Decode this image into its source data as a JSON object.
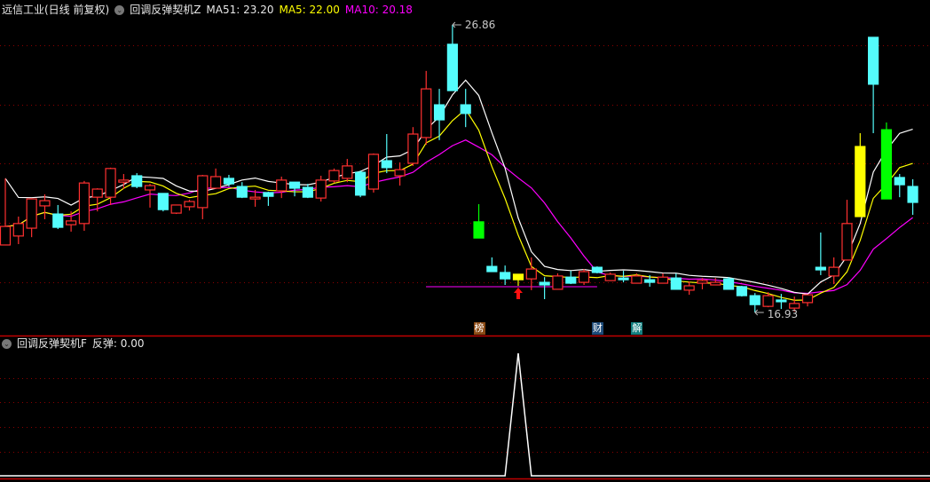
{
  "main_header": {
    "title": "远信工业(日线 前复权)",
    "indicator_name": "回调反弹契机Z",
    "ma51_label": "MA51: 23.20",
    "ma5_label": "MA5: 22.00",
    "ma10_label": "MA10: 20.18"
  },
  "sub_header": {
    "indicator_name": "回调反弹契机F",
    "value_label": "反弹: 0.00"
  },
  "markers": {
    "high_label": "26.86",
    "low_label": "16.93"
  },
  "badges": [
    {
      "text": "榜",
      "color": "#8b4a14"
    },
    {
      "text": "财",
      "color": "#1c4a78"
    },
    {
      "text": "解",
      "color": "#138080"
    }
  ],
  "colors": {
    "up": "#ff3030",
    "down": "#54fcfc",
    "ma51": "#ffffff",
    "ma5": "#ffff00",
    "ma10": "#ff00ff",
    "grid": "#8b0000",
    "signal_yellow": "#ffff00",
    "signal_green": "#00ff00"
  },
  "chart_data": {
    "type": "candlestick",
    "price_range": [
      16.93,
      26.86
    ],
    "candles": [
      {
        "o": 19.26,
        "h": 21.56,
        "l": 19.26,
        "c": 19.9
      },
      {
        "o": 19.57,
        "h": 20.24,
        "l": 19.29,
        "c": 20.0
      },
      {
        "o": 19.84,
        "h": 20.88,
        "l": 19.53,
        "c": 20.85
      },
      {
        "o": 20.61,
        "h": 21.01,
        "l": 20.15,
        "c": 20.79
      },
      {
        "o": 20.33,
        "h": 20.64,
        "l": 19.81,
        "c": 19.87
      },
      {
        "o": 19.96,
        "h": 20.42,
        "l": 19.72,
        "c": 20.09
      },
      {
        "o": 20.0,
        "h": 21.47,
        "l": 19.75,
        "c": 21.4
      },
      {
        "o": 20.91,
        "h": 21.22,
        "l": 20.42,
        "c": 21.19
      },
      {
        "o": 20.91,
        "h": 21.93,
        "l": 20.64,
        "c": 21.9
      },
      {
        "o": 21.43,
        "h": 21.71,
        "l": 21.19,
        "c": 21.5
      },
      {
        "o": 21.65,
        "h": 21.74,
        "l": 21.22,
        "c": 21.28
      },
      {
        "o": 21.16,
        "h": 21.37,
        "l": 20.55,
        "c": 21.31
      },
      {
        "o": 21.04,
        "h": 21.04,
        "l": 20.42,
        "c": 20.48
      },
      {
        "o": 20.36,
        "h": 20.64,
        "l": 20.33,
        "c": 20.64
      },
      {
        "o": 20.58,
        "h": 20.82,
        "l": 20.45,
        "c": 20.76
      },
      {
        "o": 20.55,
        "h": 21.68,
        "l": 20.15,
        "c": 21.65
      },
      {
        "o": 21.22,
        "h": 21.9,
        "l": 21.19,
        "c": 21.62
      },
      {
        "o": 21.56,
        "h": 21.68,
        "l": 21.28,
        "c": 21.37
      },
      {
        "o": 21.28,
        "h": 21.43,
        "l": 20.88,
        "c": 20.91
      },
      {
        "o": 20.85,
        "h": 21.16,
        "l": 20.58,
        "c": 20.91
      },
      {
        "o": 21.07,
        "h": 21.1,
        "l": 20.61,
        "c": 20.94
      },
      {
        "o": 21.13,
        "h": 21.62,
        "l": 20.88,
        "c": 21.5
      },
      {
        "o": 21.43,
        "h": 21.43,
        "l": 20.94,
        "c": 21.22
      },
      {
        "o": 21.25,
        "h": 21.37,
        "l": 20.88,
        "c": 20.91
      },
      {
        "o": 20.88,
        "h": 21.65,
        "l": 20.76,
        "c": 21.5
      },
      {
        "o": 21.47,
        "h": 21.9,
        "l": 21.4,
        "c": 21.83
      },
      {
        "o": 21.56,
        "h": 22.23,
        "l": 21.43,
        "c": 21.99
      },
      {
        "o": 21.77,
        "h": 21.83,
        "l": 20.91,
        "c": 20.98
      },
      {
        "o": 21.19,
        "h": 22.42,
        "l": 21.07,
        "c": 22.39
      },
      {
        "o": 22.17,
        "h": 23.09,
        "l": 21.74,
        "c": 21.93
      },
      {
        "o": 21.65,
        "h": 22.11,
        "l": 21.31,
        "c": 21.86
      },
      {
        "o": 22.08,
        "h": 23.33,
        "l": 21.99,
        "c": 23.09
      },
      {
        "o": 22.97,
        "h": 25.27,
        "l": 22.72,
        "c": 24.65
      },
      {
        "o": 24.1,
        "h": 24.65,
        "l": 22.88,
        "c": 23.58
      },
      {
        "o": 26.19,
        "h": 26.86,
        "l": 24.59,
        "c": 24.59
      },
      {
        "o": 24.1,
        "h": 24.65,
        "l": 23.33,
        "c": 23.8
      },
      {
        "o": 20.06,
        "h": 20.67,
        "l": 19.5,
        "c": 19.5,
        "color": "green"
      },
      {
        "o": 18.52,
        "h": 18.83,
        "l": 18.34,
        "c": 18.34
      },
      {
        "o": 18.31,
        "h": 18.55,
        "l": 17.88,
        "c": 18.09
      },
      {
        "o": 18.06,
        "h": 18.25,
        "l": 17.85,
        "c": 18.25,
        "color": "yellow"
      },
      {
        "o": 18.09,
        "h": 18.83,
        "l": 17.7,
        "c": 18.43
      },
      {
        "o": 17.97,
        "h": 18.15,
        "l": 17.39,
        "c": 17.88
      },
      {
        "o": 17.73,
        "h": 18.28,
        "l": 17.73,
        "c": 18.19
      },
      {
        "o": 18.15,
        "h": 18.37,
        "l": 17.91,
        "c": 17.94
      },
      {
        "o": 17.97,
        "h": 18.43,
        "l": 17.88,
        "c": 18.34
      },
      {
        "o": 18.49,
        "h": 18.52,
        "l": 18.28,
        "c": 18.31
      },
      {
        "o": 18.03,
        "h": 18.31,
        "l": 18.03,
        "c": 18.25
      },
      {
        "o": 18.12,
        "h": 18.37,
        "l": 17.97,
        "c": 18.06
      },
      {
        "o": 17.94,
        "h": 18.28,
        "l": 17.94,
        "c": 18.19
      },
      {
        "o": 18.06,
        "h": 18.22,
        "l": 17.82,
        "c": 17.97
      },
      {
        "o": 17.94,
        "h": 18.28,
        "l": 17.94,
        "c": 18.15
      },
      {
        "o": 18.12,
        "h": 18.28,
        "l": 17.73,
        "c": 17.73
      },
      {
        "o": 17.7,
        "h": 18.0,
        "l": 17.54,
        "c": 17.85
      },
      {
        "o": 17.94,
        "h": 18.12,
        "l": 17.73,
        "c": 18.03
      },
      {
        "o": 17.88,
        "h": 18.12,
        "l": 17.88,
        "c": 17.97
      },
      {
        "o": 18.09,
        "h": 18.15,
        "l": 17.73,
        "c": 17.73
      },
      {
        "o": 17.82,
        "h": 17.85,
        "l": 17.48,
        "c": 17.51
      },
      {
        "o": 17.51,
        "h": 17.6,
        "l": 16.93,
        "c": 17.2
      },
      {
        "o": 17.14,
        "h": 17.63,
        "l": 17.11,
        "c": 17.51
      },
      {
        "o": 17.36,
        "h": 17.57,
        "l": 17.05,
        "c": 17.3
      },
      {
        "o": 17.08,
        "h": 17.48,
        "l": 16.96,
        "c": 17.24
      },
      {
        "o": 17.27,
        "h": 17.54,
        "l": 17.14,
        "c": 17.54
      },
      {
        "o": 18.49,
        "h": 19.69,
        "l": 18.22,
        "c": 18.4
      },
      {
        "o": 18.19,
        "h": 18.83,
        "l": 17.91,
        "c": 18.49
      },
      {
        "o": 18.74,
        "h": 20.82,
        "l": 18.74,
        "c": 20.0
      },
      {
        "o": 20.24,
        "h": 23.12,
        "l": 20.24,
        "c": 22.66,
        "color": "yellow"
      },
      {
        "o": 26.43,
        "h": 26.43,
        "l": 23.12,
        "c": 24.81
      },
      {
        "o": 23.24,
        "h": 23.49,
        "l": 20.85,
        "c": 20.85,
        "color": "green"
      },
      {
        "o": 21.59,
        "h": 21.71,
        "l": 20.91,
        "c": 21.34
      },
      {
        "o": 21.28,
        "h": 21.53,
        "l": 20.3,
        "c": 20.73
      }
    ],
    "support_line": {
      "price": 17.91,
      "from_index": 33,
      "to_index": 45
    },
    "signal_arrow_index": 39,
    "high_index": 34,
    "low_index": 57,
    "badge_indices": [
      36,
      45,
      48
    ],
    "sub_indicator": {
      "name": "反弹",
      "signal_index": 39,
      "signal_value": 1,
      "range": [
        0,
        1
      ]
    }
  }
}
